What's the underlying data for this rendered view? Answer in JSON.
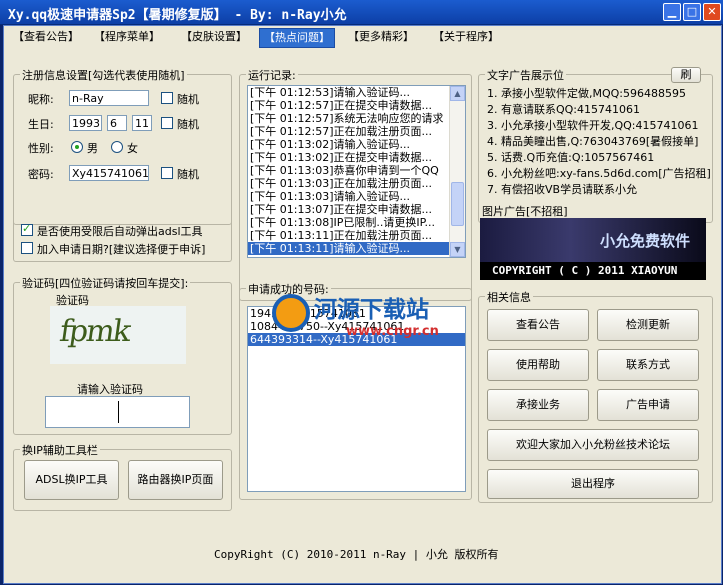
{
  "window": {
    "title": "Xy.qq极速申请器Sp2【暑期修复版】 - By: n-Ray小允",
    "controls": [
      "minimize-icon",
      "maximize-icon",
      "close-icon"
    ]
  },
  "menu": {
    "items": [
      "【查看公告】",
      "【程序菜单】",
      "【皮肤设置】",
      "【热点问题】",
      "【更多精彩】",
      "【关于程序】"
    ],
    "active_index": 3
  },
  "registration": {
    "group_title": "注册信息设置[勾选代表使用随机]",
    "nickname_label": "昵称:",
    "nickname_value": "n-Ray",
    "birthday_label": "生日:",
    "birth_year": "1993",
    "birth_month": "6",
    "birth_day": "11",
    "gender_label": "性别:",
    "gender_male": "男",
    "gender_female": "女",
    "password_label": "密码:",
    "password_value": "Xy415741061",
    "random_label": "随机"
  },
  "options": {
    "auto_popup_label": "是否使用受限后自动弹出adsl工具",
    "auto_popup_checked": true,
    "add_date_label": "加入申请日期?[建议选择便于申诉]",
    "add_date_checked": false
  },
  "captcha": {
    "group_title": "验证码[四位验证码请按回车提交]:",
    "image_label": "验证码",
    "image_text": "fpmk",
    "input_label": "请输入验证码"
  },
  "ip_tools": {
    "group_title": "换IP辅助工具栏",
    "adsl_button": "ADSL换IP工具",
    "router_button": "路由器换IP页面"
  },
  "log": {
    "group_title": "运行记录:",
    "lines": [
      "[下午 01:12:53]请输入验证码...",
      "[下午 01:12:57]正在提交申请数据...",
      "[下午 01:12:57]系统无法响应您的请求",
      "[下午 01:12:57]正在加载注册页面...",
      "[下午 01:13:02]请输入验证码...",
      "[下午 01:13:02]正在提交申请数据...",
      "[下午 01:13:03]恭喜你申请到一个QQ",
      "[下午 01:13:03]正在加载注册页面...",
      "[下午 01:13:03]请输入验证码...",
      "[下午 01:13:07]正在提交申请数据...",
      "[下午 01:13:08]IP已限制..请更换IP...",
      "[下午 01:13:11]正在加载注册页面...",
      "[下午 01:13:11]请输入验证码..."
    ],
    "selected_index": 12
  },
  "accounts": {
    "group_title": "申请成功的号码:",
    "lines": [
      "194...--Xy415741061",
      "1084437750--Xy415741061",
      "644393314--Xy415741061"
    ],
    "selected_index": 2
  },
  "text_ads": {
    "group_title": "文字广告展示位",
    "refresh_button": "刷",
    "lines": [
      "1. 承接小型软件定做,MQQ:596488595",
      "2. 有意请联系QQ:415741061",
      "3. 小允承接小型软件开发,QQ:415741061",
      "4. 精品美瞳出售,Q:763043769[暑假接单]",
      "5. 话费.Q币充值:Q:1057567461",
      "6. 小允粉丝吧:xy-fans.5d6d.com[广告招租]",
      "7. 有偿招收VB学员请联系小允"
    ]
  },
  "image_ad": {
    "group_title": "图片广告[不招租]",
    "banner_text": "小允免费软件",
    "copyright_text": "COPYRIGHT  ( C )  2011  XIAOYUN"
  },
  "related": {
    "group_title": "相关信息",
    "buttons": [
      "查看公告",
      "检测更新",
      "使用帮助",
      "联系方式",
      "承接业务",
      "广告申请"
    ],
    "forum_button": "欢迎大家加入小允粉丝技术论坛",
    "exit_button": "退出程序"
  },
  "watermark": {
    "name": "河源下载站",
    "url": "www.cngr.cn"
  },
  "footer": {
    "text": "CopyRight (C) 2010-2011 n-Ray | 小允 版权所有"
  },
  "colors": {
    "title_bar": "#1b5ccf",
    "client_bg": "#ece9d8",
    "selection": "#316ac5"
  }
}
